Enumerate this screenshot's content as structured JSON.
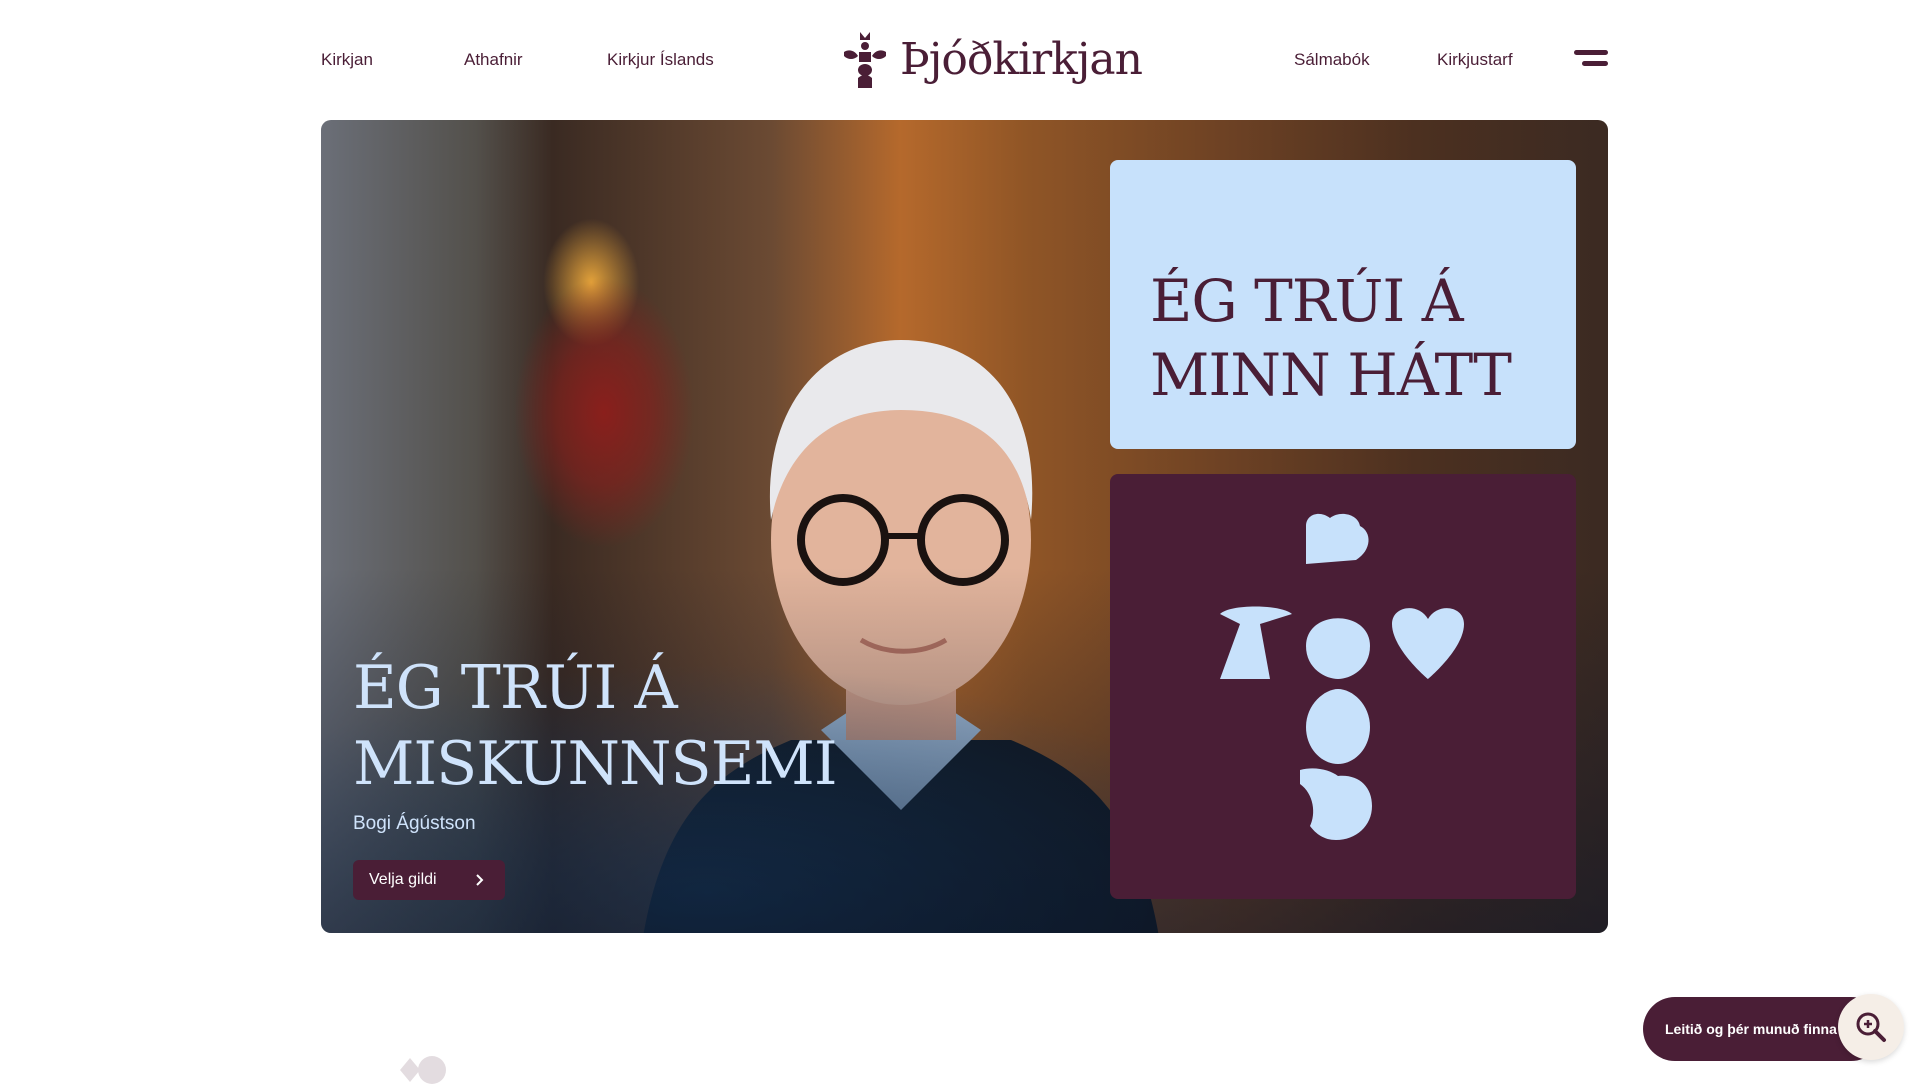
{
  "nav": {
    "left": [
      "Kirkjan",
      "Athafnir",
      "Kirkjur Íslands"
    ],
    "right": [
      "Sálmabók",
      "Kirkjustarf"
    ],
    "logo_text": "Þjóðkirkjan"
  },
  "hero": {
    "title_line1": "ÉG TRÚI Á",
    "title_line2": "MISKUNNSEMI",
    "author": "Bogi Ágústson",
    "cta_label": "Velja gildi"
  },
  "quote_card": {
    "line1": "ÉG TRÚI Á",
    "line2": "MINN HÁTT"
  },
  "search": {
    "label": "Leitið og þér munuð finna"
  },
  "colors": {
    "brand": "#4a1e36",
    "light_blue": "#c7e1fb",
    "search_circle": "#f5eee7"
  },
  "icons": [
    "logo-cross-icon",
    "menu-icon",
    "chevron-right-icon",
    "search-icon",
    "leaf-icon",
    "tree-icon",
    "heart-star-icon",
    "shell-icon",
    "hands-icon",
    "dove-icon"
  ]
}
